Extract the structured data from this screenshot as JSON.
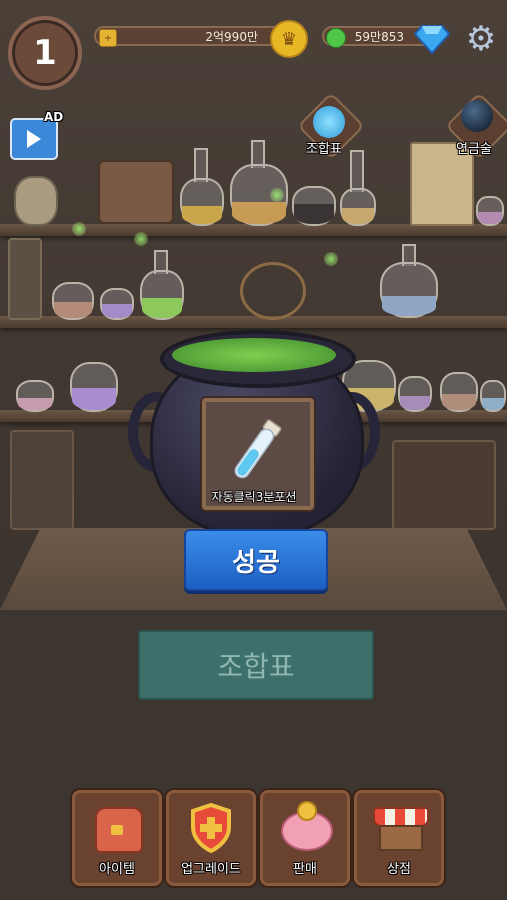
{
  "player": {
    "level": "1"
  },
  "currency": {
    "gold": "2억990만",
    "green": "59만853"
  },
  "icons": {
    "level": "level-badge",
    "gold": "crown-icon",
    "green": "green-coin-icon",
    "gem": "diamond-icon",
    "settings": "gear-icon",
    "ad": "video-ad-icon"
  },
  "top_icons": [
    {
      "label": "조합표",
      "icon": "recipe-orb-icon"
    },
    {
      "label": "연금술",
      "icon": "crystal-ball-icon"
    }
  ],
  "ad": {
    "badge": "AD"
  },
  "result": {
    "item_name": "자동클릭3분포션",
    "status_button": "성공"
  },
  "recipe_button": "조합표",
  "bottom_menu": [
    {
      "label": "아이템",
      "icon": "backpack-icon"
    },
    {
      "label": "업그레이드",
      "icon": "shield-plus-icon"
    },
    {
      "label": "판매",
      "icon": "piggy-bank-icon"
    },
    {
      "label": "상점",
      "icon": "shop-stall-icon"
    }
  ],
  "colors": {
    "success_button": "#2a76d8",
    "recipe_button": "#3d6f6b",
    "cauldron_liquid": "#6fc048"
  }
}
